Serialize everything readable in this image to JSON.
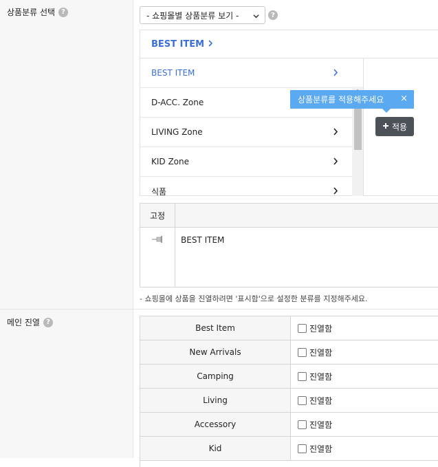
{
  "category_select": {
    "label": "상품분류 선택",
    "help": "?",
    "dropdown_value": "- 쇼핑몰별 상품분류 보기 -"
  },
  "panel": {
    "header": "BEST ITEM",
    "items": [
      {
        "label": "BEST ITEM",
        "active": true
      },
      {
        "label": "D-ACC. Zone",
        "active": false
      },
      {
        "label": "LIVING Zone",
        "active": false
      },
      {
        "label": "KID Zone",
        "active": false
      },
      {
        "label": "식품",
        "active": false
      }
    ]
  },
  "tooltip": {
    "text": "상품분류를 적용해주세요",
    "close": "×"
  },
  "apply_button": {
    "label": "적용"
  },
  "fixed_table": {
    "header": "고정",
    "row": {
      "name": "BEST ITEM"
    }
  },
  "note": "- 쇼핑몰에 상품을 진열하려면 '표시함'으로 설정한 분류를 지정해주세요.",
  "main_display": {
    "label": "메인 진열",
    "help": "?",
    "option_label": "진열함",
    "rows": [
      "Best Item",
      "New Arrivals",
      "Camping",
      "Living",
      "Accessory",
      "Kid"
    ]
  },
  "colors": {
    "accent": "#3a6fd8",
    "tooltip": "#5aa9f1",
    "button": "#4d5259"
  }
}
